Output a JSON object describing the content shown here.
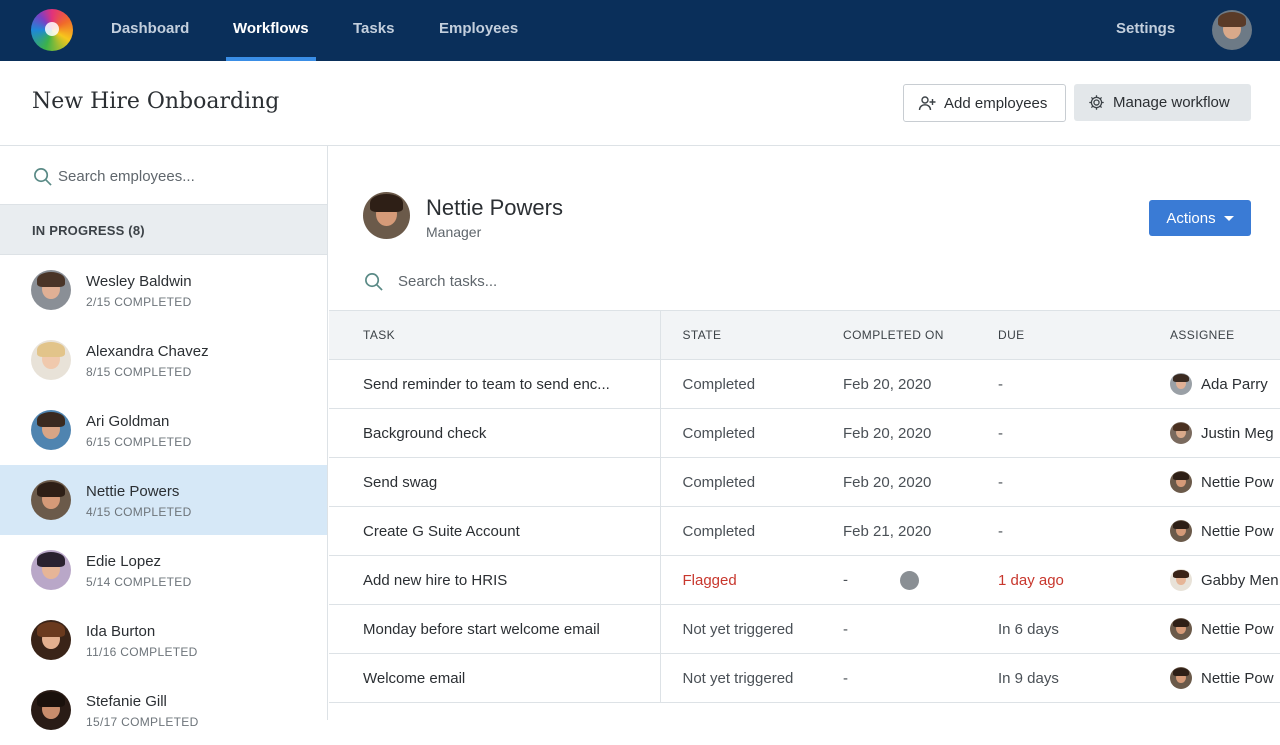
{
  "nav": {
    "items": [
      "Dashboard",
      "Workflows",
      "Tasks",
      "Employees"
    ],
    "active": "Workflows",
    "settings": "Settings"
  },
  "page": {
    "title": "New Hire Onboarding",
    "add_employees": "Add employees",
    "manage_workflow": "Manage workflow"
  },
  "sidebar": {
    "search_placeholder": "Search employees...",
    "section_label": "IN PROGRESS (8)",
    "employees": [
      {
        "name": "Wesley Baldwin",
        "progress": "2/15 COMPLETED"
      },
      {
        "name": "Alexandra Chavez",
        "progress": "8/15 COMPLETED"
      },
      {
        "name": "Ari Goldman",
        "progress": "6/15 COMPLETED"
      },
      {
        "name": "Nettie Powers",
        "progress": "4/15 COMPLETED"
      },
      {
        "name": "Edie Lopez",
        "progress": "5/14 COMPLETED"
      },
      {
        "name": "Ida Burton",
        "progress": "11/16 COMPLETED"
      },
      {
        "name": "Stefanie Gill",
        "progress": "15/17 COMPLETED"
      }
    ],
    "selected_index": 3
  },
  "profile": {
    "name": "Nettie Powers",
    "role": "Manager",
    "actions_label": "Actions"
  },
  "tasks": {
    "search_placeholder": "Search tasks...",
    "headers": [
      "TASK",
      "STATE",
      "COMPLETED ON",
      "DUE",
      "ASSIGNEE"
    ],
    "rows": [
      {
        "task": "Send reminder to team to send enc...",
        "state": "Completed",
        "completed_on": "Feb 20, 2020",
        "due": "-",
        "assignee": "Ada Parry"
      },
      {
        "task": "Background check",
        "state": "Completed",
        "completed_on": "Feb 20, 2020",
        "due": "-",
        "assignee": "Justin Meg"
      },
      {
        "task": "Send swag",
        "state": "Completed",
        "completed_on": "Feb 20, 2020",
        "due": "-",
        "assignee": "Nettie Pow"
      },
      {
        "task": "Create G Suite Account",
        "state": "Completed",
        "completed_on": "Feb 21, 2020",
        "due": "-",
        "assignee": "Nettie Pow"
      },
      {
        "task": "Add new hire to HRIS",
        "state": "Flagged",
        "completed_on": "-",
        "due": "1 day ago",
        "assignee": "Gabby Men"
      },
      {
        "task": "Monday before start welcome email",
        "state": "Not yet triggered",
        "completed_on": "-",
        "due": "In 6 days",
        "assignee": "Nettie Pow"
      },
      {
        "task": "Welcome email",
        "state": "Not yet triggered",
        "completed_on": "-",
        "due": "In 9 days",
        "assignee": "Nettie Pow"
      }
    ]
  },
  "colors": {
    "nav_bg": "#0a2f5a",
    "accent": "#3a7bd5",
    "selected_row": "#d6e8f7",
    "flagged": "#c8372d"
  }
}
